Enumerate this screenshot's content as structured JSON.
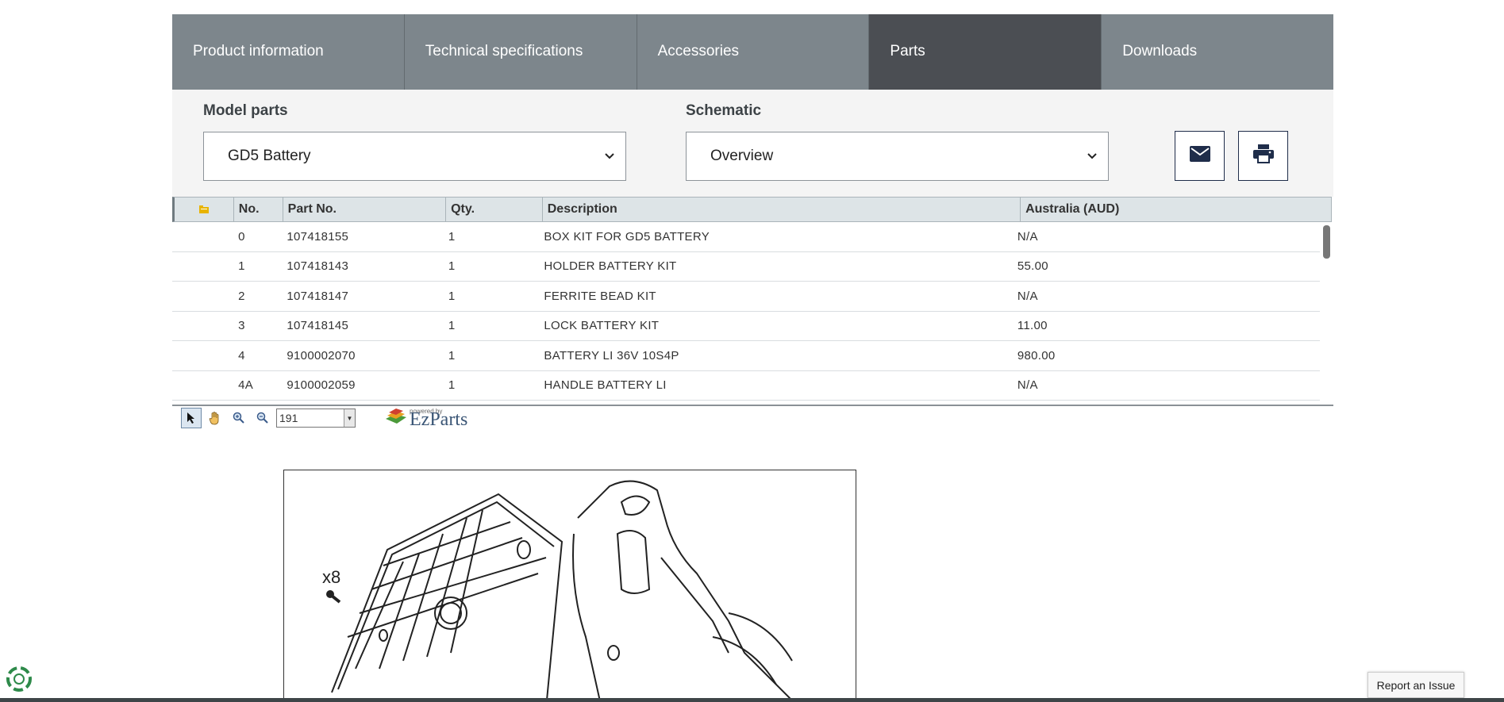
{
  "tabs": [
    {
      "label": "Product information",
      "active": false
    },
    {
      "label": "Technical specifications",
      "active": false
    },
    {
      "label": "Accessories",
      "active": false
    },
    {
      "label": "Parts",
      "active": true
    },
    {
      "label": "Downloads",
      "active": false
    }
  ],
  "filters": {
    "model_label": "Model parts",
    "model_value": "GD5 Battery",
    "schematic_label": "Schematic",
    "schematic_value": "Overview"
  },
  "actions": {
    "email_icon": "envelope-icon",
    "print_icon": "printer-icon"
  },
  "table": {
    "headers": [
      "No.",
      "Part No.",
      "Qty.",
      "Description",
      "Australia (AUD)"
    ],
    "rows": [
      {
        "no": "0",
        "part": "107418155",
        "qty": "1",
        "desc": "BOX KIT FOR GD5 BATTERY",
        "price": "N/A"
      },
      {
        "no": "1",
        "part": "107418143",
        "qty": "1",
        "desc": "HOLDER BATTERY KIT",
        "price": "55.00"
      },
      {
        "no": "2",
        "part": "107418147",
        "qty": "1",
        "desc": "FERRITE BEAD KIT",
        "price": "N/A"
      },
      {
        "no": "3",
        "part": "107418145",
        "qty": "1",
        "desc": "LOCK BATTERY KIT",
        "price": "11.00"
      },
      {
        "no": "4",
        "part": "9100002070",
        "qty": "1",
        "desc": "BATTERY LI 36V 10S4P",
        "price": "980.00"
      },
      {
        "no": "4A",
        "part": "9100002059",
        "qty": "1",
        "desc": "HANDLE BATTERY LI",
        "price": "N/A"
      }
    ]
  },
  "viewer": {
    "zoom": "191",
    "powered_by": "powered by",
    "brand": "EzParts"
  },
  "schematic": {
    "label": "x8"
  },
  "footer": {
    "report_label": "Report an Issue"
  },
  "colors": {
    "tab_bg": "#7d868c",
    "tab_active": "#4b4e53",
    "icon_border": "#1f2d4a"
  }
}
